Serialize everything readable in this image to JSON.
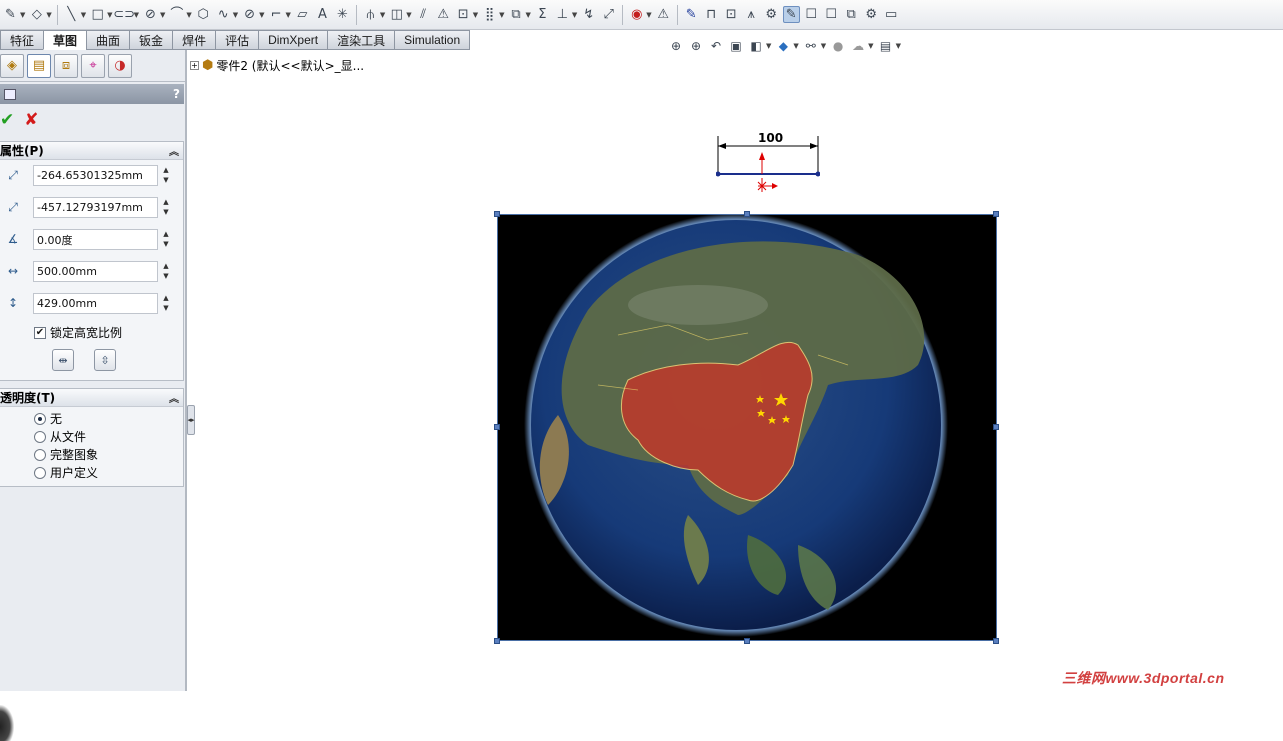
{
  "toolbar": {
    "icons": [
      "sketch-icon",
      "smart-dimension-icon",
      "line-icon",
      "rectangle-icon",
      "slot-icon",
      "circle-icon",
      "arc-icon",
      "polygon-icon",
      "spline-icon",
      "ellipse-icon",
      "fillet-icon",
      "plane-icon",
      "text-icon",
      "point-icon",
      "centerline-icon",
      "trim-icon",
      "convert-icon",
      "offset-icon",
      "mirror-icon",
      "move-icon",
      "linear-pattern-icon",
      "copy-icon",
      "sum-icon",
      "relations-icon",
      "repair-icon",
      "quick-snaps-icon",
      "instant3d-icon",
      "rapid-sketch-icon",
      "shaded-sketch-icon",
      "sketch-picture-icon",
      "spline-tools-icon",
      "block-icon",
      "insert-block-icon",
      "make-block-icon",
      "save-block-icon",
      "picture-icon"
    ]
  },
  "tabs": [
    "特征",
    "草图",
    "曲面",
    "钣金",
    "焊件",
    "评估",
    "DimXpert",
    "渲染工具",
    "Simulation"
  ],
  "active_tab": "草图",
  "property_manager": {
    "help": "?",
    "group_properties": "属性(P)",
    "x_value": "-264.65301325mm",
    "y_value": "-457.12793197mm",
    "angle_value": "0.00度",
    "width_value": "500.00mm",
    "height_value": "429.00mm",
    "lock_ratio_label": "锁定高宽比例",
    "group_transparency": "透明度(T)",
    "radio_options": [
      "无",
      "从文件",
      "完整图象",
      "用户定义"
    ],
    "radio_selected": 0
  },
  "tree": {
    "label": "零件2 (默认<<默认>_显..."
  },
  "canvas": {
    "dimension_text": "100",
    "picture_subject": "earth-globe-asia-china-highlighted"
  },
  "watermark": "三维网www.3dportal.cn",
  "colors": {
    "accent": "#1f3b9a",
    "china_highlight": "#c0392b",
    "selection": "#4a6fa5",
    "dimension_line": "#1a2e8c",
    "ok_green": "#23a023",
    "cancel_red": "#d31a1a"
  }
}
